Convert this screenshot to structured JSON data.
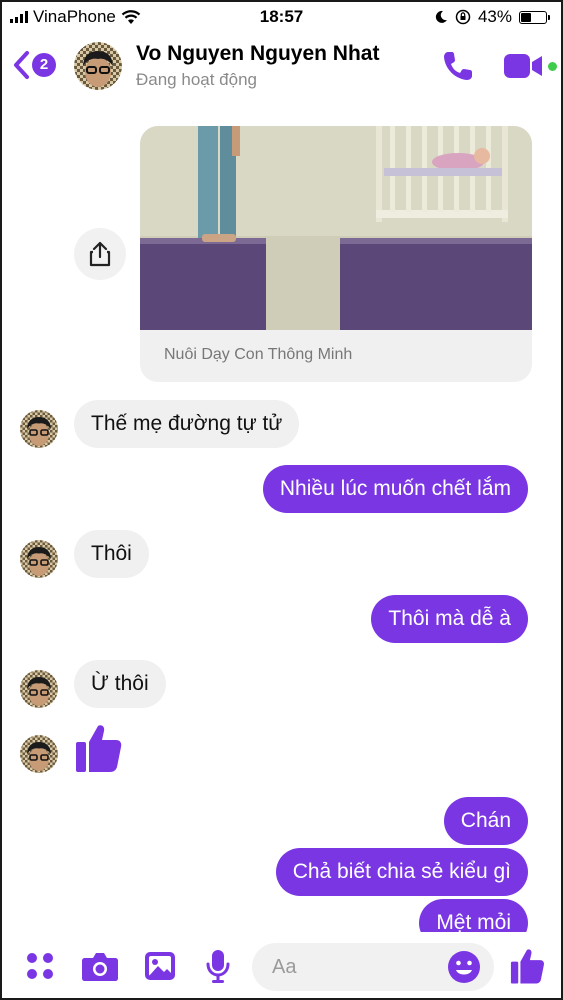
{
  "status_bar": {
    "carrier": "VinaPhone",
    "time": "18:57",
    "battery": "43%",
    "battery_level": 0.43
  },
  "header": {
    "unread_count": "2",
    "contact_name": "Vo Nguyen Nguyen Nhat",
    "presence": "Đang hoạt động",
    "accent_color": "#7b36e4",
    "icons": [
      "back-chevron-icon",
      "phone-icon",
      "video-camera-icon"
    ]
  },
  "shared_link": {
    "source": "Nuôi Dạy Con Thông Minh"
  },
  "messages": [
    {
      "side": "in",
      "text": "Thế mẹ đường tự tử"
    },
    {
      "side": "out",
      "text": "Nhiều lúc muốn chết lắm"
    },
    {
      "side": "in",
      "text": "Thôi"
    },
    {
      "side": "out",
      "text": "Thôi mà dễ à"
    },
    {
      "side": "in",
      "text": "Ừ thôi"
    },
    {
      "side": "in",
      "type": "like-sticker"
    },
    {
      "side": "out",
      "text": "Chán"
    },
    {
      "side": "out",
      "text": "Chả biết chia sẻ kiểu gì"
    },
    {
      "side": "out",
      "text": "Mệt mỏi"
    }
  ],
  "composer": {
    "placeholder": "Aa",
    "icons": [
      "apps-grid-icon",
      "camera-icon",
      "gallery-icon",
      "microphone-icon",
      "emoji-icon",
      "thumbs-up-icon"
    ]
  }
}
